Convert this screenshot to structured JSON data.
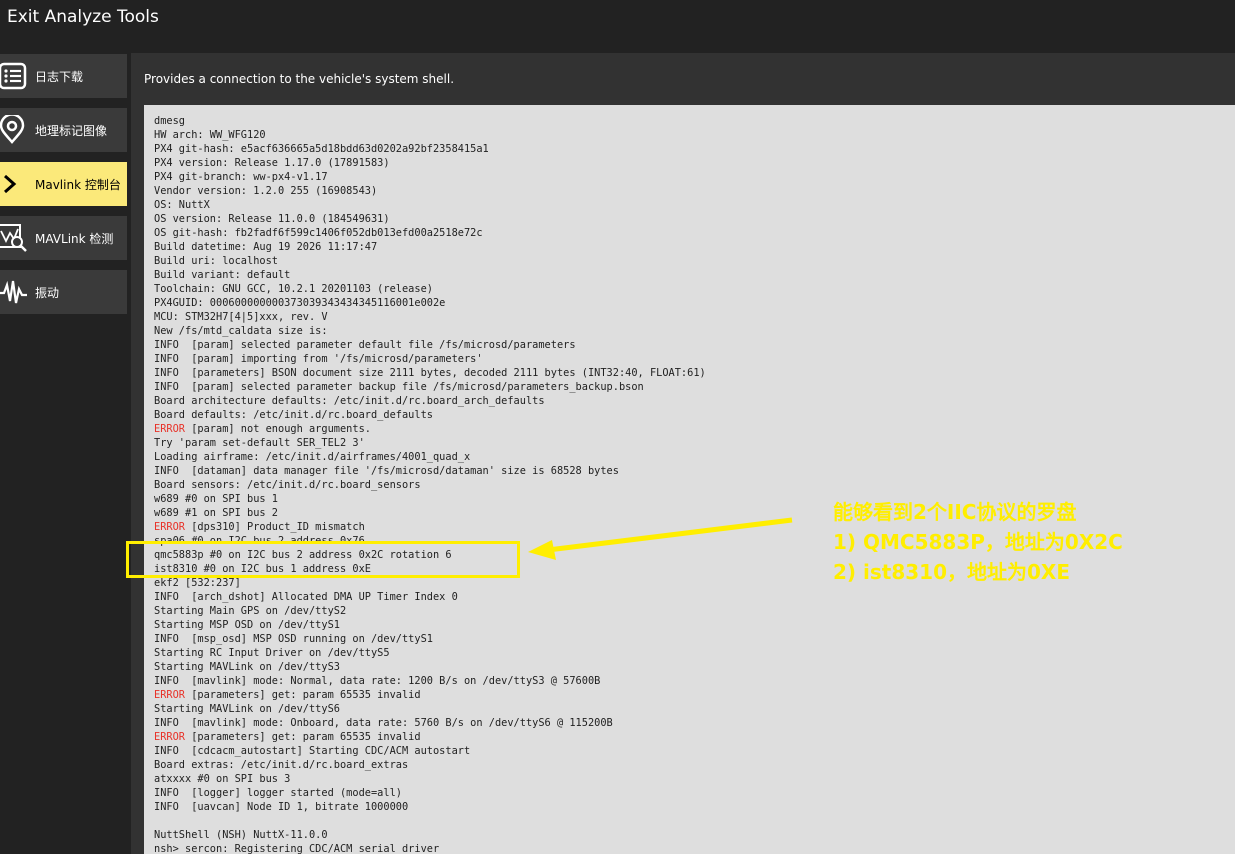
{
  "window": {
    "title": "Exit Analyze Tools"
  },
  "sidebar": {
    "items": [
      {
        "label": "日志下载",
        "icon": "list-icon",
        "active": false
      },
      {
        "label": "地理标记图像",
        "icon": "location-pin-icon",
        "active": false
      },
      {
        "label": "Mavlink 控制台",
        "icon": "chevron-right-icon",
        "active": true
      },
      {
        "label": "MAVLink 检测",
        "icon": "chart-inspect-icon",
        "active": false
      },
      {
        "label": "振动",
        "icon": "waveform-icon",
        "active": false
      }
    ]
  },
  "main": {
    "description": "Provides a connection to the vehicle's system shell.",
    "console_lines": [
      "dmesg",
      "HW arch: WW_WFG120",
      "PX4 git-hash: e5acf636665a5d18bdd63d0202a92bf2358415a1",
      "PX4 version: Release 1.17.0 (17891583)",
      "PX4 git-branch: ww-px4-v1.17",
      "Vendor version: 1.2.0 255 (16908543)",
      "OS: NuttX",
      "OS version: Release 11.0.0 (184549631)",
      "OS git-hash: fb2fadf6f599c1406f052db013efd00a2518e72c",
      "Build datetime: Aug 19 2026 11:17:47",
      "Build uri: localhost",
      "Build variant: default",
      "Toolchain: GNU GCC, 10.2.1 20201103 (release)",
      "PX4GUID: 000600000000373039343434345116001e002e",
      "MCU: STM32H7[4|5]xxx, rev. V",
      "New /fs/mtd_caldata size is:",
      "INFO  [param] selected parameter default file /fs/microsd/parameters",
      "INFO  [param] importing from '/fs/microsd/parameters'",
      "INFO  [parameters] BSON document size 2111 bytes, decoded 2111 bytes (INT32:40, FLOAT:61)",
      "INFO  [param] selected parameter backup file /fs/microsd/parameters_backup.bson",
      "Board architecture defaults: /etc/init.d/rc.board_arch_defaults",
      "Board defaults: /etc/init.d/rc.board_defaults",
      "ERROR [param] not enough arguments.",
      "Try 'param set-default SER_TEL2 3'",
      "Loading airframe: /etc/init.d/airframes/4001_quad_x",
      "INFO  [dataman] data manager file '/fs/microsd/dataman' size is 68528 bytes",
      "Board sensors: /etc/init.d/rc.board_sensors",
      "w689 #0 on SPI bus 1",
      "w689 #1 on SPI bus 2",
      "ERROR [dps310] Product_ID mismatch",
      "spa06 #0 on I2C bus 2 address 0x76",
      "qmc5883p #0 on I2C bus 2 address 0x2C rotation 6",
      "ist8310 #0 on I2C bus 1 address 0xE",
      "ekf2 [532:237]",
      "INFO  [arch_dshot] Allocated DMA UP Timer Index 0",
      "Starting Main GPS on /dev/ttyS2",
      "Starting MSP OSD on /dev/ttyS1",
      "INFO  [msp_osd] MSP OSD running on /dev/ttyS1",
      "Starting RC Input Driver on /dev/ttyS5",
      "Starting MAVLink on /dev/ttyS3",
      "INFO  [mavlink] mode: Normal, data rate: 1200 B/s on /dev/ttyS3 @ 57600B",
      "ERROR [parameters] get: param 65535 invalid",
      "Starting MAVLink on /dev/ttyS6",
      "INFO  [mavlink] mode: Onboard, data rate: 5760 B/s on /dev/ttyS6 @ 115200B",
      "ERROR [parameters] get: param 65535 invalid",
      "INFO  [cdcacm_autostart] Starting CDC/ACM autostart",
      "Board extras: /etc/init.d/rc.board_extras",
      "atxxxx #0 on SPI bus 3",
      "INFO  [logger] logger started (mode=all)",
      "INFO  [uavcan] Node ID 1, bitrate 1000000",
      "",
      "NuttShell (NSH) NuttX-11.0.0",
      "nsh> sercon: Registering CDC/ACM serial driver"
    ]
  },
  "annotation": {
    "lines": [
      "能够看到2个IIC协议的罗盘",
      "1) QMC5883P，地址为0X2C",
      "2) ist8310，地址为0XE"
    ],
    "color": "#ffee00"
  },
  "colors": {
    "error": "#e8332a",
    "active_tab": "#fbe97a",
    "terminal_bg": "#dedede"
  }
}
